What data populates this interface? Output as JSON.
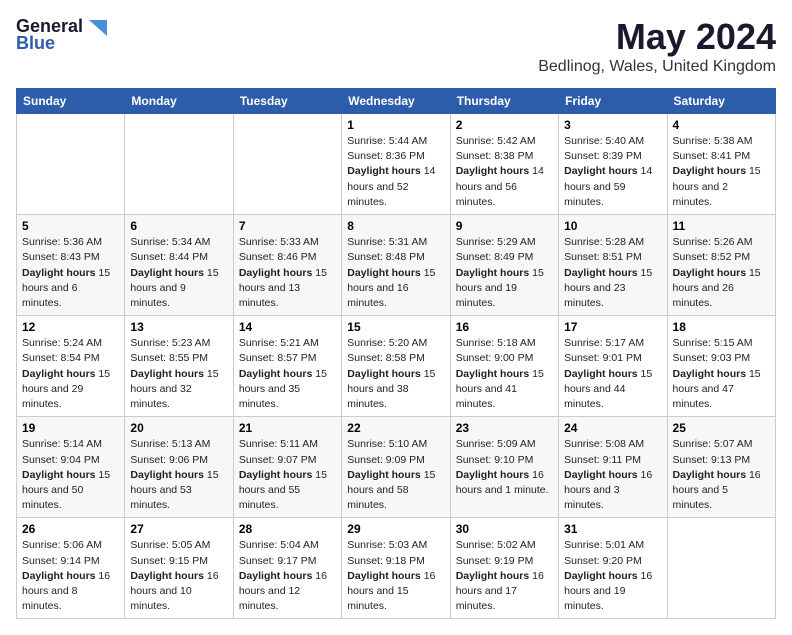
{
  "logo": {
    "general": "General",
    "blue": "Blue"
  },
  "title": {
    "month": "May 2024",
    "location": "Bedlinog, Wales, United Kingdom"
  },
  "weekdays": [
    "Sunday",
    "Monday",
    "Tuesday",
    "Wednesday",
    "Thursday",
    "Friday",
    "Saturday"
  ],
  "weeks": [
    [
      {
        "day": null,
        "info": null
      },
      {
        "day": null,
        "info": null
      },
      {
        "day": null,
        "info": null
      },
      {
        "day": "1",
        "info": "Sunrise: 5:44 AM\nSunset: 8:36 PM\nDaylight: 14 hours and 52 minutes."
      },
      {
        "day": "2",
        "info": "Sunrise: 5:42 AM\nSunset: 8:38 PM\nDaylight: 14 hours and 56 minutes."
      },
      {
        "day": "3",
        "info": "Sunrise: 5:40 AM\nSunset: 8:39 PM\nDaylight: 14 hours and 59 minutes."
      },
      {
        "day": "4",
        "info": "Sunrise: 5:38 AM\nSunset: 8:41 PM\nDaylight: 15 hours and 2 minutes."
      }
    ],
    [
      {
        "day": "5",
        "info": "Sunrise: 5:36 AM\nSunset: 8:43 PM\nDaylight: 15 hours and 6 minutes."
      },
      {
        "day": "6",
        "info": "Sunrise: 5:34 AM\nSunset: 8:44 PM\nDaylight: 15 hours and 9 minutes."
      },
      {
        "day": "7",
        "info": "Sunrise: 5:33 AM\nSunset: 8:46 PM\nDaylight: 15 hours and 13 minutes."
      },
      {
        "day": "8",
        "info": "Sunrise: 5:31 AM\nSunset: 8:48 PM\nDaylight: 15 hours and 16 minutes."
      },
      {
        "day": "9",
        "info": "Sunrise: 5:29 AM\nSunset: 8:49 PM\nDaylight: 15 hours and 19 minutes."
      },
      {
        "day": "10",
        "info": "Sunrise: 5:28 AM\nSunset: 8:51 PM\nDaylight: 15 hours and 23 minutes."
      },
      {
        "day": "11",
        "info": "Sunrise: 5:26 AM\nSunset: 8:52 PM\nDaylight: 15 hours and 26 minutes."
      }
    ],
    [
      {
        "day": "12",
        "info": "Sunrise: 5:24 AM\nSunset: 8:54 PM\nDaylight: 15 hours and 29 minutes."
      },
      {
        "day": "13",
        "info": "Sunrise: 5:23 AM\nSunset: 8:55 PM\nDaylight: 15 hours and 32 minutes."
      },
      {
        "day": "14",
        "info": "Sunrise: 5:21 AM\nSunset: 8:57 PM\nDaylight: 15 hours and 35 minutes."
      },
      {
        "day": "15",
        "info": "Sunrise: 5:20 AM\nSunset: 8:58 PM\nDaylight: 15 hours and 38 minutes."
      },
      {
        "day": "16",
        "info": "Sunrise: 5:18 AM\nSunset: 9:00 PM\nDaylight: 15 hours and 41 minutes."
      },
      {
        "day": "17",
        "info": "Sunrise: 5:17 AM\nSunset: 9:01 PM\nDaylight: 15 hours and 44 minutes."
      },
      {
        "day": "18",
        "info": "Sunrise: 5:15 AM\nSunset: 9:03 PM\nDaylight: 15 hours and 47 minutes."
      }
    ],
    [
      {
        "day": "19",
        "info": "Sunrise: 5:14 AM\nSunset: 9:04 PM\nDaylight: 15 hours and 50 minutes."
      },
      {
        "day": "20",
        "info": "Sunrise: 5:13 AM\nSunset: 9:06 PM\nDaylight: 15 hours and 53 minutes."
      },
      {
        "day": "21",
        "info": "Sunrise: 5:11 AM\nSunset: 9:07 PM\nDaylight: 15 hours and 55 minutes."
      },
      {
        "day": "22",
        "info": "Sunrise: 5:10 AM\nSunset: 9:09 PM\nDaylight: 15 hours and 58 minutes."
      },
      {
        "day": "23",
        "info": "Sunrise: 5:09 AM\nSunset: 9:10 PM\nDaylight: 16 hours and 1 minute."
      },
      {
        "day": "24",
        "info": "Sunrise: 5:08 AM\nSunset: 9:11 PM\nDaylight: 16 hours and 3 minutes."
      },
      {
        "day": "25",
        "info": "Sunrise: 5:07 AM\nSunset: 9:13 PM\nDaylight: 16 hours and 5 minutes."
      }
    ],
    [
      {
        "day": "26",
        "info": "Sunrise: 5:06 AM\nSunset: 9:14 PM\nDaylight: 16 hours and 8 minutes."
      },
      {
        "day": "27",
        "info": "Sunrise: 5:05 AM\nSunset: 9:15 PM\nDaylight: 16 hours and 10 minutes."
      },
      {
        "day": "28",
        "info": "Sunrise: 5:04 AM\nSunset: 9:17 PM\nDaylight: 16 hours and 12 minutes."
      },
      {
        "day": "29",
        "info": "Sunrise: 5:03 AM\nSunset: 9:18 PM\nDaylight: 16 hours and 15 minutes."
      },
      {
        "day": "30",
        "info": "Sunrise: 5:02 AM\nSunset: 9:19 PM\nDaylight: 16 hours and 17 minutes."
      },
      {
        "day": "31",
        "info": "Sunrise: 5:01 AM\nSunset: 9:20 PM\nDaylight: 16 hours and 19 minutes."
      },
      {
        "day": null,
        "info": null
      }
    ]
  ]
}
